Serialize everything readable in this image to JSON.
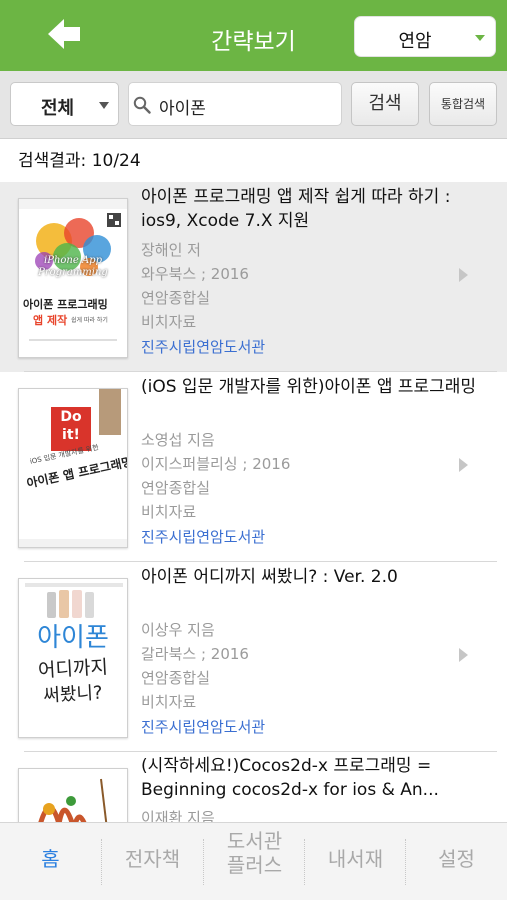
{
  "header": {
    "title": "간략보기",
    "library_select": "연암",
    "accent_color": "#6cb544",
    "back_icon": "back-arrow-icon"
  },
  "search": {
    "scope": "전체",
    "query": "아이폰",
    "search_button": "검색",
    "unified_search_button": "통합검색"
  },
  "result_count": "검색결과: 10/24",
  "results": [
    {
      "title": "아이폰 프로그래밍 앱 제작 쉽게 따라 하기 : ios9, Xcode 7.X 지원",
      "author": "장해인 저",
      "publisher": "와우북스 ; 2016",
      "location": "연암종합실",
      "material": "비치자료",
      "library": "진주시립연암도서관",
      "cover": {
        "banner": "iPhone App Programming",
        "line1": "아이폰 프로그래밍",
        "line2": "앱 제작",
        "line3": "쉽게 따라 하기"
      }
    },
    {
      "title": "(iOS 입문 개발자를 위한)아이폰 앱 프로그래밍",
      "author": "소영섭 지음",
      "publisher": "이지스퍼블리싱 ; 2016",
      "location": "연암종합실",
      "material": "비치자료",
      "library": "진주시립연암도서관",
      "cover": {
        "badge_line1": "Do",
        "badge_line2": "it!",
        "subtitle": "iOS 입문 개발자를 위한",
        "main": "아이폰 앱 프로그래밍"
      }
    },
    {
      "title": "아이폰 어디까지 써봤니? : Ver. 2.0",
      "author": "이상우 지음",
      "publisher": "갈라북스 ; 2016",
      "location": "연암종합실",
      "material": "비치자료",
      "library": "진주시립연암도서관",
      "cover": {
        "line1": "아이폰",
        "line2": "어디까지",
        "line3": "써봤니?"
      }
    },
    {
      "title": "(시작하세요!)Cocos2d-x 프로그래밍 = Beginning cocos2d-x for ios & An...",
      "author": "이재환 지음"
    }
  ],
  "tabs": [
    {
      "label": "홈",
      "active": true
    },
    {
      "label": "전자책",
      "active": false
    },
    {
      "label": "도서관\n플러스",
      "active": false
    },
    {
      "label": "내서재",
      "active": false
    },
    {
      "label": "설정",
      "active": false
    }
  ],
  "link_color": "#3b6fd1",
  "active_tab_color": "#2a7fe0"
}
